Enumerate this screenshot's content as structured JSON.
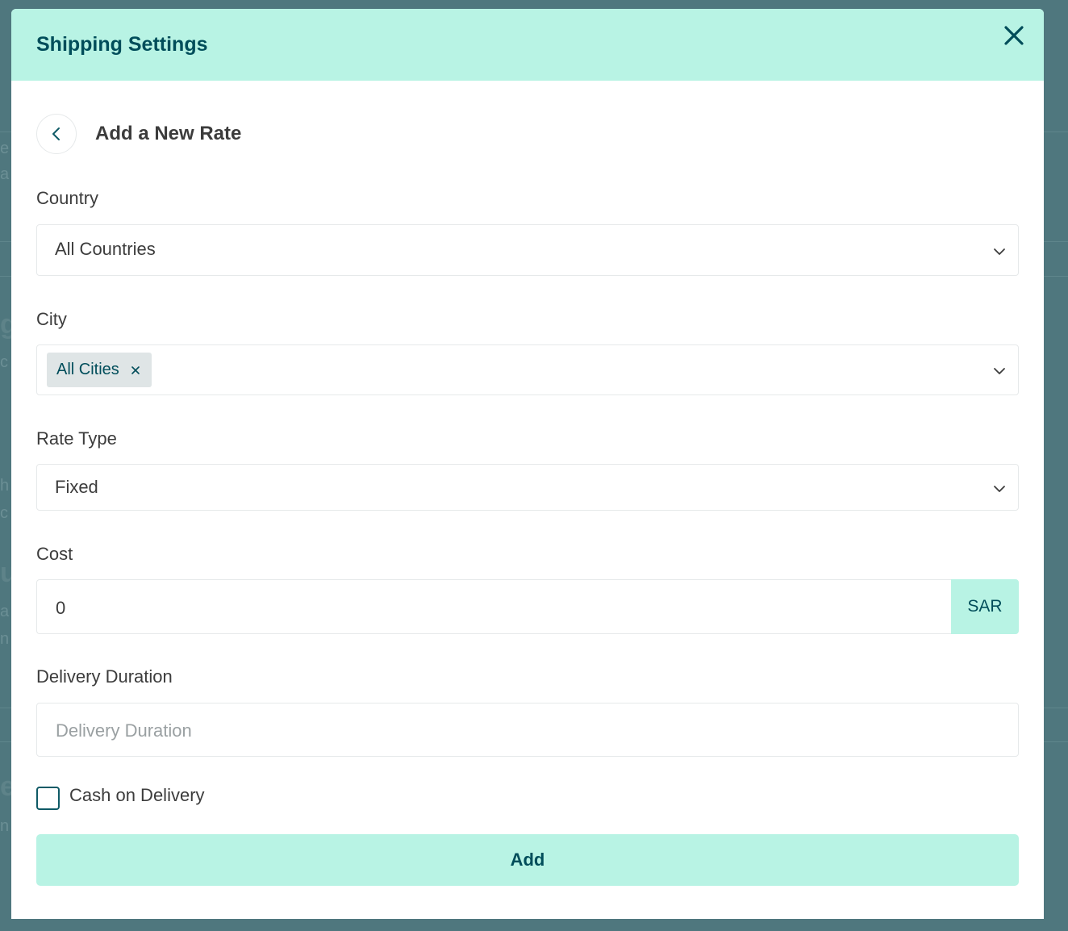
{
  "modal": {
    "title": "Shipping Settings",
    "close_icon": "close-icon"
  },
  "subheader": {
    "back_icon": "chevron-left-icon",
    "title": "Add a New Rate"
  },
  "country": {
    "label": "Country",
    "selected": "All Countries"
  },
  "city": {
    "label": "City",
    "chips": [
      {
        "label": "All Cities"
      }
    ]
  },
  "rate_type": {
    "label": "Rate Type",
    "selected": "Fixed"
  },
  "cost": {
    "label": "Cost",
    "value": "0",
    "currency": "SAR"
  },
  "delivery_duration": {
    "label": "Delivery Duration",
    "placeholder": "Delivery Duration",
    "value": ""
  },
  "cash_on_delivery": {
    "label": "Cash on Delivery",
    "checked": false
  },
  "actions": {
    "add_label": "Add"
  },
  "colors": {
    "header_bg": "#b8f3e4",
    "accent_text": "#004d5a",
    "overlay": "#4f777e"
  }
}
